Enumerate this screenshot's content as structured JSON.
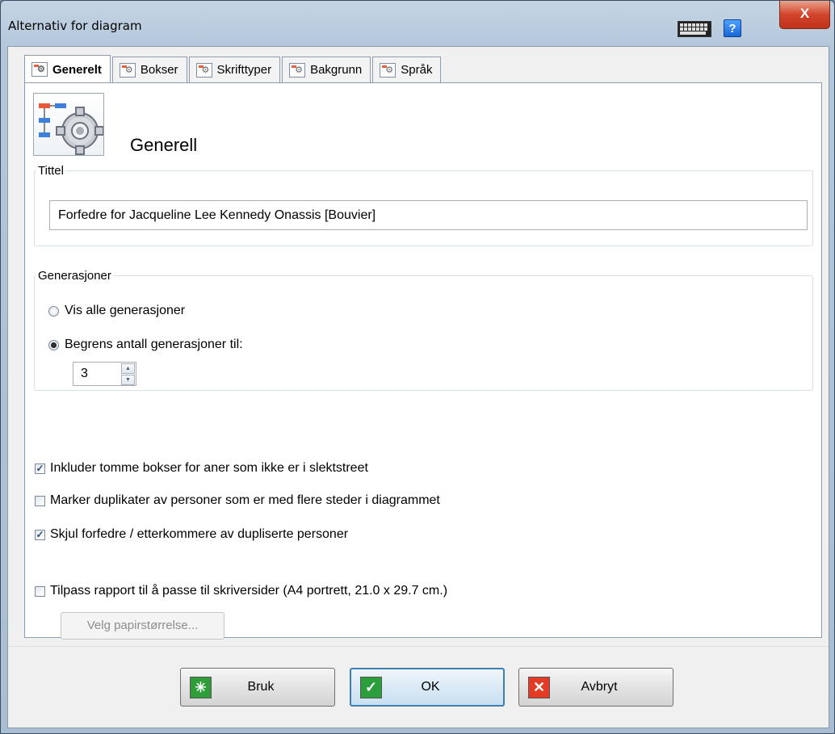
{
  "window": {
    "title": "Alternativ for diagram",
    "help_label": "?",
    "close_label": "X"
  },
  "tabs": [
    {
      "label": "Generelt",
      "active": true
    },
    {
      "label": "Bokser",
      "active": false
    },
    {
      "label": "Skrifttyper",
      "active": false
    },
    {
      "label": "Bakgrunn",
      "active": false
    },
    {
      "label": "Språk",
      "active": false
    }
  ],
  "panel": {
    "heading": "Generell"
  },
  "title_group": {
    "legend": "Tittel",
    "value": "Forfedre for Jacqueline Lee Kennedy Onassis [Bouvier]"
  },
  "generations": {
    "legend": "Generasjoner",
    "option_all": "Vis alle generasjoner",
    "option_limit": "Begrens antall generasjoner til:",
    "selected": "limit",
    "limit_value": "3"
  },
  "options": {
    "include_empty": {
      "label": "Inkluder tomme bokser for aner som ikke er i slektstreet",
      "checked": true
    },
    "mark_duplicates": {
      "label": "Marker duplikater av personer som er med flere steder i diagrammet",
      "checked": false
    },
    "hide_duplicates": {
      "label": "Skjul forfedre / etterkommere av dupliserte personer",
      "checked": true
    },
    "fit_pages": {
      "label": "Tilpass rapport til å passe til skriversider (A4 portrett, 21.0 x 29.7 cm.)",
      "checked": false
    }
  },
  "paper_button": "Velg papirstørrelse...",
  "buttons": {
    "apply": "Bruk",
    "ok": "OK",
    "cancel": "Avbryt"
  }
}
